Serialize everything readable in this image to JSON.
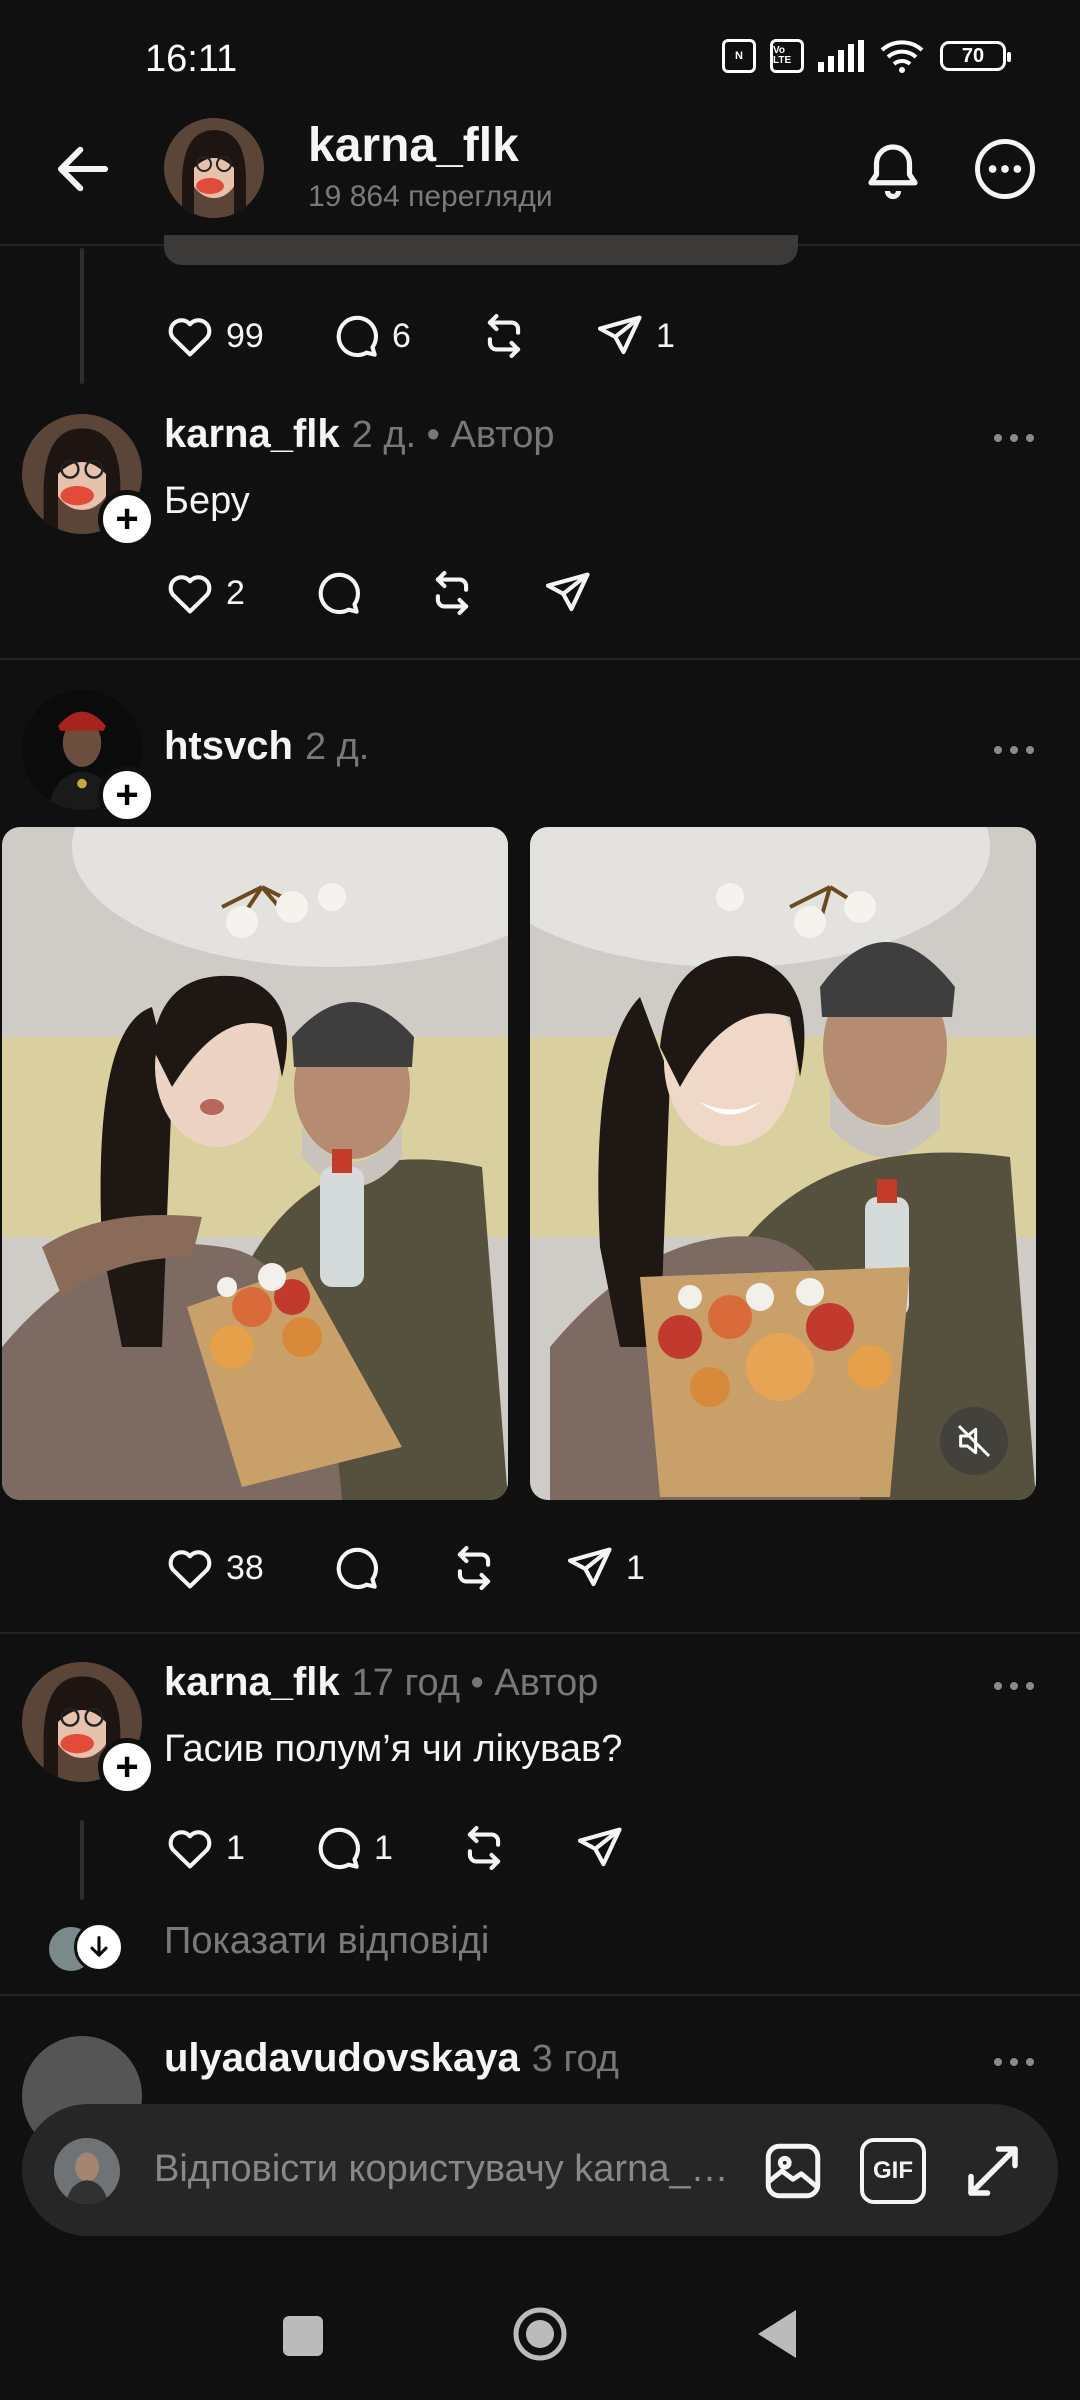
{
  "status_bar": {
    "time": "16:11",
    "nfc_label": "N",
    "volte_label": "Vo LTE",
    "battery": "70"
  },
  "header": {
    "title": "karna_flk",
    "subtitle": "19 864 перегляди"
  },
  "top_post": {
    "likes": "99",
    "comments": "6",
    "shares": "1"
  },
  "replies": [
    {
      "username": "karna_flk",
      "meta": "2 д. • Автор",
      "text": "Беру",
      "likes": "2",
      "comments": "",
      "shares": ""
    },
    {
      "username": "htsvch",
      "meta": "2 д.",
      "likes": "38",
      "comments": "",
      "shares": "1"
    },
    {
      "username": "karna_flk",
      "meta": "17 год • Автор",
      "text": "Гасив полум’я чи лікував?",
      "likes": "1",
      "comments": "1",
      "shares": ""
    },
    {
      "username": "ulyadavudovskaya",
      "meta": "3 год"
    }
  ],
  "show_replies": "Показати відповіді",
  "reply_bar": {
    "placeholder": "Відповісти користувачу karna_flk…",
    "gif_label": "GIF"
  },
  "colors": {
    "background": "#101010",
    "text": "#f3f5f7",
    "muted": "#777777",
    "divider": "#232323",
    "reply_bar": "#262626"
  },
  "icons": [
    "back-arrow-icon",
    "bell-icon",
    "more-icon",
    "heart-icon",
    "comment-icon",
    "repost-icon",
    "share-icon",
    "plus-icon",
    "mute-icon",
    "image-icon",
    "gif-icon",
    "expand-icon"
  ]
}
